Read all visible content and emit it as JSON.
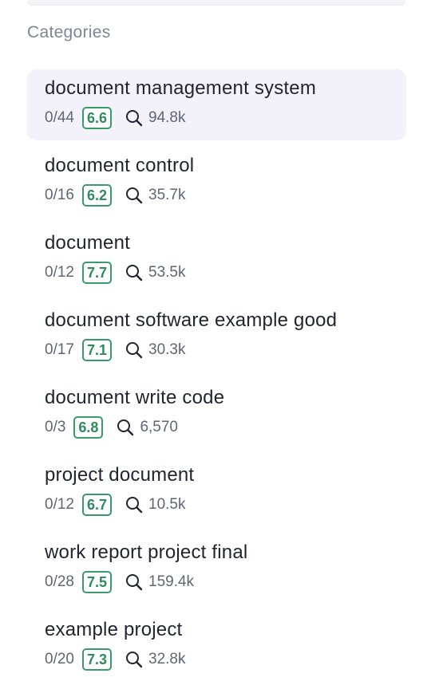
{
  "section": {
    "title": "Categories"
  },
  "items": [
    {
      "title": "document management system",
      "count": "0/44",
      "score": "6.6",
      "volume": "94.8k",
      "active": true
    },
    {
      "title": "document control",
      "count": "0/16",
      "score": "6.2",
      "volume": "35.7k",
      "active": false
    },
    {
      "title": "document",
      "count": "0/12",
      "score": "7.7",
      "volume": "53.5k",
      "active": false
    },
    {
      "title": "document software example good",
      "count": "0/17",
      "score": "7.1",
      "volume": "30.3k",
      "active": false
    },
    {
      "title": "document write code",
      "count": "0/3",
      "score": "6.8",
      "volume": "6,570",
      "active": false
    },
    {
      "title": "project document",
      "count": "0/12",
      "score": "6.7",
      "volume": "10.5k",
      "active": false
    },
    {
      "title": "work report project final",
      "count": "0/28",
      "score": "7.5",
      "volume": "159.4k",
      "active": false
    },
    {
      "title": "example project",
      "count": "0/20",
      "score": "7.3",
      "volume": "32.8k",
      "active": false
    }
  ],
  "colors": {
    "active_background": "#f3f2fb",
    "score_green": "#2f8a5f",
    "muted_text": "#7d8598"
  },
  "icons": {
    "volume": "search-icon"
  }
}
